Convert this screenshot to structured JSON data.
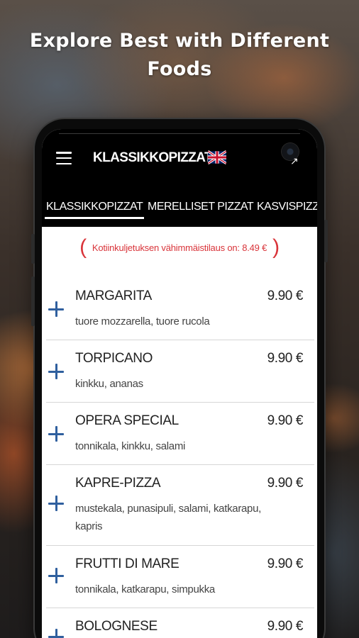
{
  "headline": "Explore Best with Different Foods",
  "app": {
    "title": "KLASSIKKOPIZZAT",
    "language_flag": "uk-flag-icon"
  },
  "tabs": [
    {
      "label": "KLASSIKKOPIZZAT",
      "active": true
    },
    {
      "label": "MERELLISET PIZZAT",
      "active": false
    },
    {
      "label": "KASVISPIZZ",
      "active": false
    }
  ],
  "notice": "Kotiinkuljetuksen vähimmäistilaus on: 8.49 €",
  "menu_items": [
    {
      "name": "MARGARITA",
      "price": "9.90 €",
      "description": "tuore mozzarella, tuore rucola"
    },
    {
      "name": "TORPICANO",
      "price": "9.90 €",
      "description": "kinkku, ananas"
    },
    {
      "name": "OPERA SPECIAL",
      "price": "9.90 €",
      "description": "tonnikala, kinkku, salami"
    },
    {
      "name": "KAPRE-PIZZA",
      "price": "9.90 €",
      "description": "mustekala, punasipuli, salami, katkarapu, kapris"
    },
    {
      "name": "FRUTTI DI MARE",
      "price": "9.90 €",
      "description": "tonnikala, katkarapu, simpukka"
    },
    {
      "name": "BOLOGNESE",
      "price": "9.90 €",
      "description": ""
    }
  ],
  "colors": {
    "accent_plus": "#2f5f9e",
    "notice_red": "#d9343a",
    "header_bg": "#000000"
  }
}
